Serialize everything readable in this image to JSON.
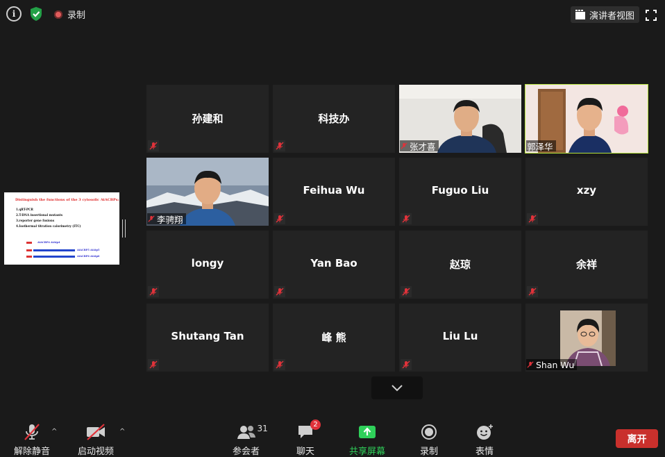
{
  "topbar": {
    "recording_label": "录制",
    "presenter_view_label": "演讲者视图"
  },
  "share_thumbnail": {
    "title": "Distinguish the functions of the 3 cytosolic AtACBPs:",
    "lines": [
      "1.qRT-PCR",
      "2.T-DNA insertional mutants",
      "3.reporter gene fusions",
      "4.Isothermal titration calorimetry (ITC)"
    ],
    "markers": [
      "AtACBP4  AtAtp4",
      "AtACBP5  AtAtp5",
      "AtACBP6  AtAtp6"
    ]
  },
  "participants": [
    {
      "name": "孙建和",
      "video": false
    },
    {
      "name": "科技办",
      "video": false
    },
    {
      "name": "张才喜",
      "video": true
    },
    {
      "name": "郭泽华",
      "video": true,
      "active_speaker": true
    },
    {
      "name": "李骋翔",
      "video": true
    },
    {
      "name": "Feihua Wu",
      "video": false
    },
    {
      "name": "Fuguo Liu",
      "video": false
    },
    {
      "name": "xzy",
      "video": false
    },
    {
      "name": "longy",
      "video": false
    },
    {
      "name": "Yan Bao",
      "video": false
    },
    {
      "name": "赵琼",
      "video": false
    },
    {
      "name": "余祥",
      "video": false
    },
    {
      "name": "Shutang Tan",
      "video": false
    },
    {
      "name": "峰 熊",
      "video": false
    },
    {
      "name": "Liu Lu",
      "video": false
    },
    {
      "name": "Shan Wu",
      "video": true
    }
  ],
  "toolbar": {
    "unmute_label": "解除静音",
    "start_video_label": "启动视频",
    "participants_label": "参会者",
    "participants_count": "31",
    "chat_label": "聊天",
    "chat_badge": "2",
    "share_label": "共享屏幕",
    "record_label": "录制",
    "reactions_label": "表情",
    "leave_label": "离开"
  },
  "colors": {
    "active_speaker": "#b5e23b",
    "share_green": "#2fd05a",
    "leave_red": "#c9302c",
    "mute_red": "#e0323a"
  }
}
